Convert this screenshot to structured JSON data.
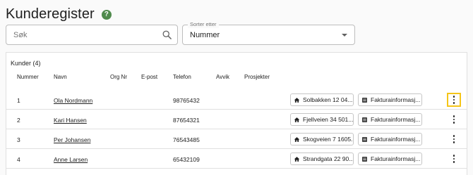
{
  "page": {
    "title": "Kunderegister",
    "help_icon": "?"
  },
  "search": {
    "placeholder": "Søk",
    "value": ""
  },
  "sort": {
    "label": "Sorter etter",
    "value": "Nummer"
  },
  "table": {
    "title": "Kunder (4)",
    "columns": [
      "Nummer",
      "Navn",
      "Org Nr",
      "E-post",
      "Telefon",
      "Avvik",
      "Prosjekter"
    ],
    "rows": [
      {
        "number": "1",
        "name": "Ola Nordmann",
        "orgnr": "",
        "email": "",
        "phone": "98765432",
        "address": "Solbakken 12 04...",
        "invoice": "Fakturainformasj..."
      },
      {
        "number": "2",
        "name": "Kari Hansen",
        "orgnr": "",
        "email": "",
        "phone": "87654321",
        "address": "Fjellveien 34 501...",
        "invoice": "Fakturainformasj..."
      },
      {
        "number": "3",
        "name": "Per Johansen",
        "orgnr": "",
        "email": "",
        "phone": "76543485",
        "address": "Skogveien 7 1605...",
        "invoice": "Fakturainformasj..."
      },
      {
        "number": "4",
        "name": "Anne Larsen",
        "orgnr": "",
        "email": "",
        "phone": "65432109",
        "address": "Strandgata 22 90...",
        "invoice": "Fakturainformasj..."
      }
    ]
  },
  "icons": {
    "address": "home-icon",
    "invoice": "document-icon",
    "more": "more-vertical-icon",
    "search": "search-icon"
  },
  "colors": {
    "help": "#4f8a4c",
    "focus": "#f5c518"
  }
}
